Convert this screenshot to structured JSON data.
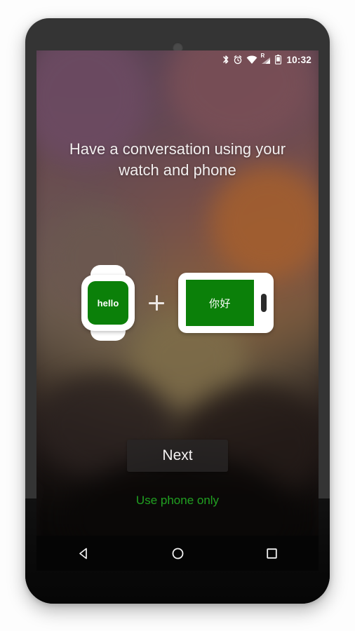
{
  "device": {
    "type": "android-phone-mockup",
    "bezel_color": "#343434",
    "body_bottom_color": "#0a0a0a"
  },
  "status_bar": {
    "icons": [
      "bluetooth-icon",
      "alarm-clock-icon",
      "wifi-icon",
      "cellular-signal-roaming-icon",
      "battery-icon"
    ],
    "roaming_indicator": "R",
    "time": "10:32"
  },
  "screen": {
    "headline": "Have a conversation using your watch and phone",
    "wallpaper_description": "blurred photo, purple-mauve top fading to warm brown and black"
  },
  "illustration": {
    "watch": {
      "icon": "smartwatch-icon",
      "screen_text": "hello",
      "screen_color": "#0b8009",
      "body_color": "#ffffff"
    },
    "connector": "plus-icon",
    "phone": {
      "icon": "phone-landscape-icon",
      "screen_text": "你好",
      "screen_color": "#0b8009",
      "body_color": "#ffffff"
    }
  },
  "actions": {
    "next_label": "Next",
    "use_phone_only_label": "Use phone only",
    "next_bg_color": "#282626",
    "link_color": "#21a021"
  },
  "nav_bar": {
    "back": "back-triangle-icon",
    "home": "home-circle-icon",
    "recents": "recents-square-icon"
  }
}
